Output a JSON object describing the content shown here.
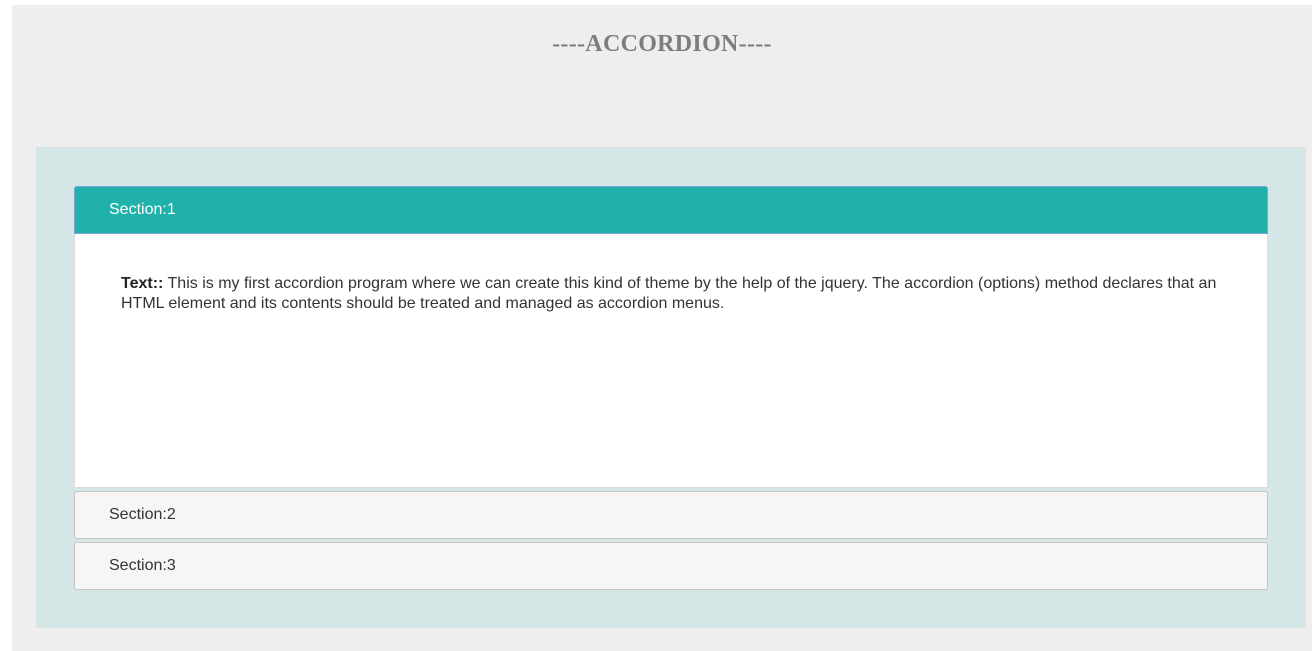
{
  "page": {
    "title": "----ACCORDION----"
  },
  "accordion": {
    "sections": [
      {
        "label": "Section:1",
        "expanded": true,
        "content_label": "Text::",
        "content_text": " This is my first accordion program where we can create this kind of theme by the help of the jquery. The accordion (options) method declares that an HTML element and its contents should be treated and managed as accordion menus."
      },
      {
        "label": "Section:2",
        "expanded": false
      },
      {
        "label": "Section:3",
        "expanded": false
      }
    ]
  },
  "colors": {
    "background": "#eeeeee",
    "panel": "#d5e6e6",
    "active_header": "#20b2aa",
    "collapsed_header": "#f6f6f6",
    "title_text": "#7d7d7d"
  }
}
